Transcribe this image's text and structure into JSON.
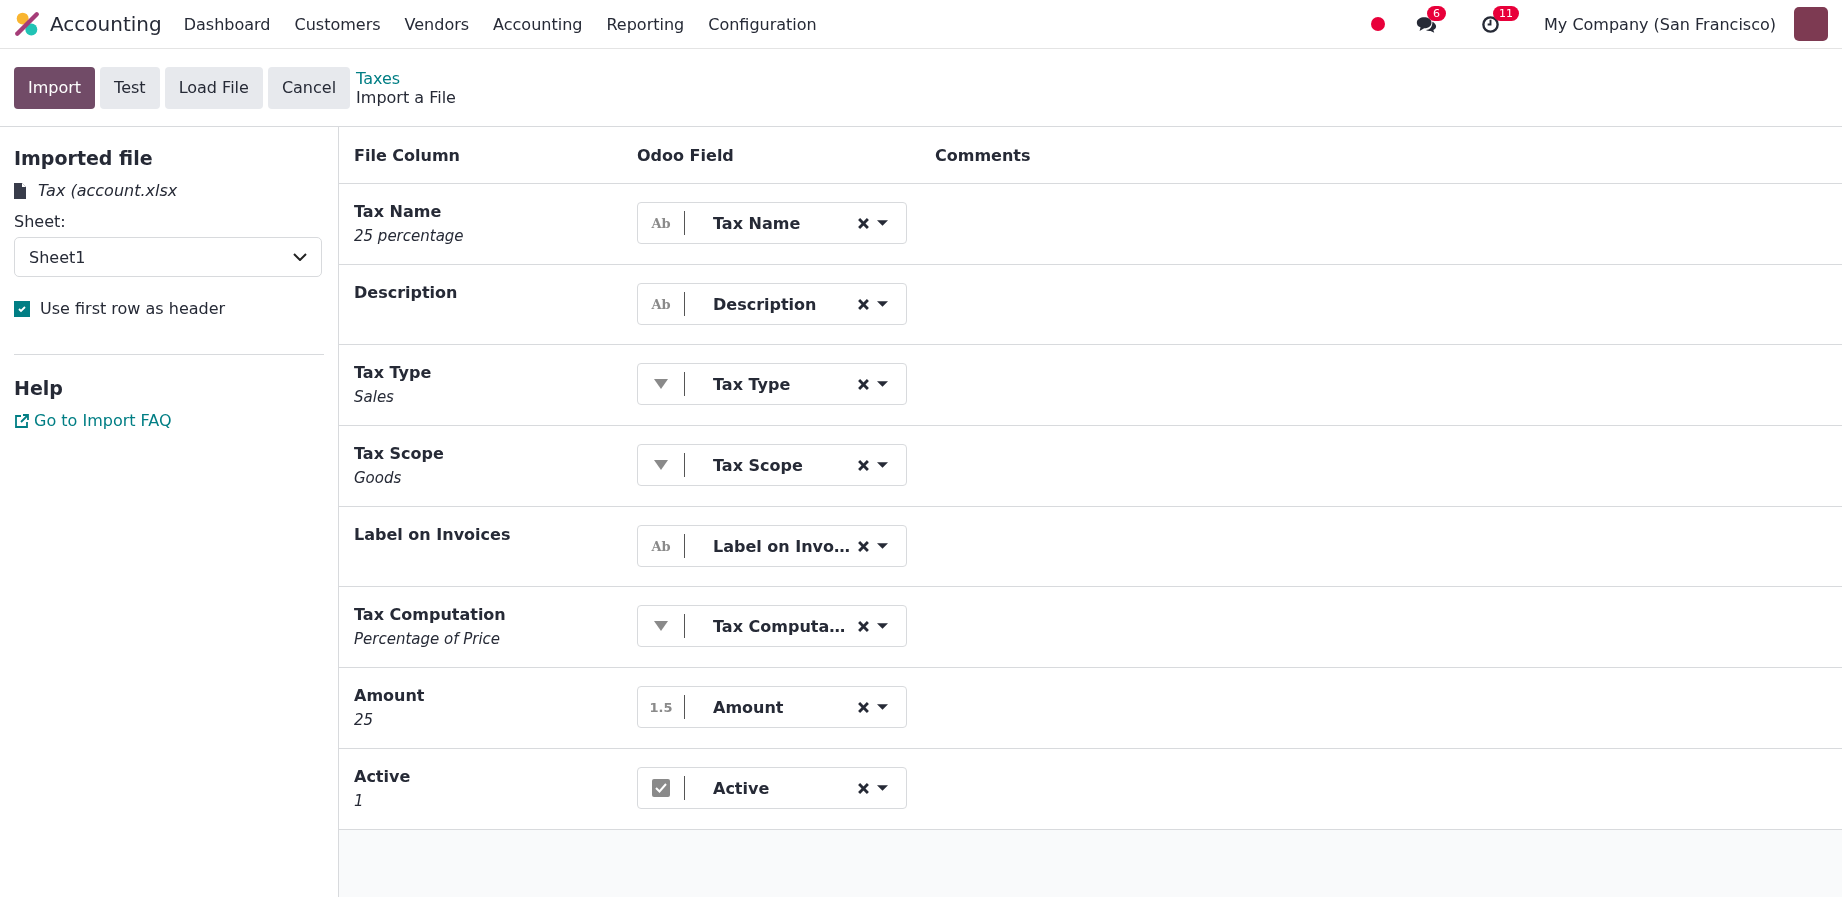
{
  "navbar": {
    "app_name": "Accounting",
    "menu": [
      "Dashboard",
      "Customers",
      "Vendors",
      "Accounting",
      "Reporting",
      "Configuration"
    ],
    "messages_badge": "6",
    "activities_badge": "11",
    "company": "My Company (San Francisco)"
  },
  "actions": {
    "buttons": [
      {
        "label": "Import",
        "kind": "primary"
      },
      {
        "label": "Test",
        "kind": "secondary"
      },
      {
        "label": "Load File",
        "kind": "secondary"
      },
      {
        "label": "Cancel",
        "kind": "secondary"
      }
    ],
    "breadcrumb": "Taxes",
    "page_title": "Import a File"
  },
  "sidebar": {
    "title": "Imported file",
    "file_name": "Tax (account.xlsx",
    "sheet_label": "Sheet:",
    "sheet_value": "Sheet1",
    "header_option": {
      "label": "Use first row as header",
      "checked": true
    },
    "help_title": "Help",
    "help_link": "Go to Import FAQ"
  },
  "table": {
    "columns": [
      "File Column",
      "Odoo Field",
      "Comments"
    ],
    "rows": [
      {
        "column": "Tax Name",
        "sample": "25 percentage",
        "field": "Tax Name",
        "kind": "text",
        "type_label": "Ab"
      },
      {
        "column": "Description",
        "field": "Description",
        "kind": "text",
        "type_label": "Ab"
      },
      {
        "column": "Tax Type",
        "sample": "Sales",
        "field": "Tax Type",
        "kind": "selection"
      },
      {
        "column": "Tax Scope",
        "sample": "Goods",
        "field": "Tax Scope",
        "kind": "selection"
      },
      {
        "column": "Label on Invoices",
        "field": "Label on Invo…",
        "kind": "text",
        "type_label": "Ab"
      },
      {
        "column": "Tax Computation",
        "sample": "Percentage of Price",
        "field": "Tax Computa…",
        "kind": "selection"
      },
      {
        "column": "Amount",
        "sample": "25",
        "field": "Amount",
        "kind": "number",
        "type_label": "1.5"
      },
      {
        "column": "Active",
        "sample": "1",
        "field": "Active",
        "kind": "boolean"
      }
    ]
  }
}
